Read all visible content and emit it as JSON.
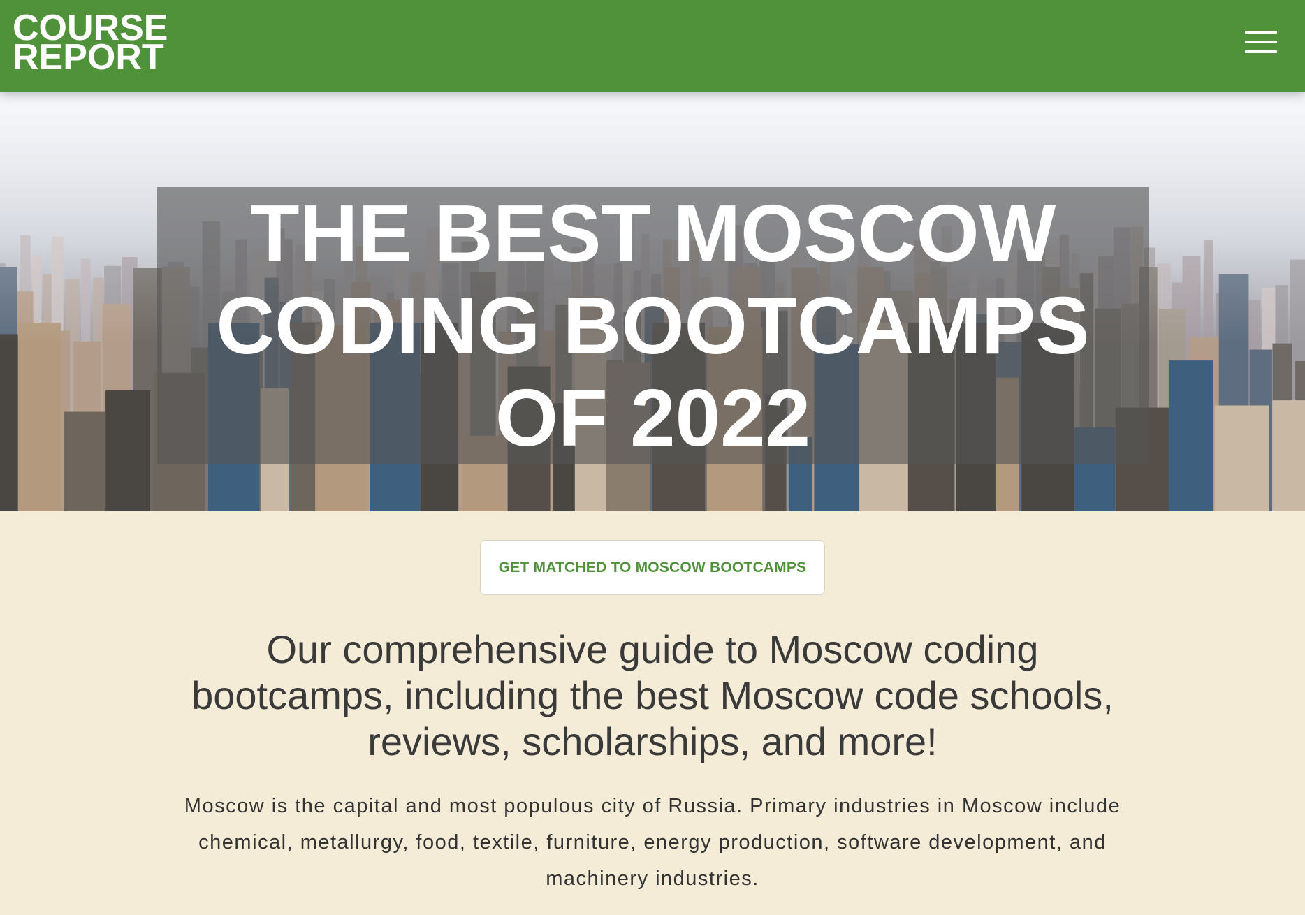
{
  "header": {
    "logo_line1": "COURSE",
    "logo_line2": "REPORT",
    "brand_color": "#4f923a",
    "menu_icon": "hamburger-menu-icon"
  },
  "hero": {
    "title": "THE BEST MOSCOW CODING BOOTCAMPS OF 2022",
    "background": "aerial city skyline photo"
  },
  "cta": {
    "label": "GET MATCHED TO MOSCOW BOOTCAMPS"
  },
  "content": {
    "subtitle": "Our comprehensive guide to Moscow coding bootcamps, including the best Moscow code schools, reviews, scholarships, and more!",
    "intro": "Moscow is the capital and most populous city of Russia. Primary industries in Moscow include chemical, metallurgy, food, textile, furniture, energy production, software development, and machinery industries."
  },
  "colors": {
    "page_background": "#f5ecd7",
    "cta_text": "#4f923a"
  }
}
